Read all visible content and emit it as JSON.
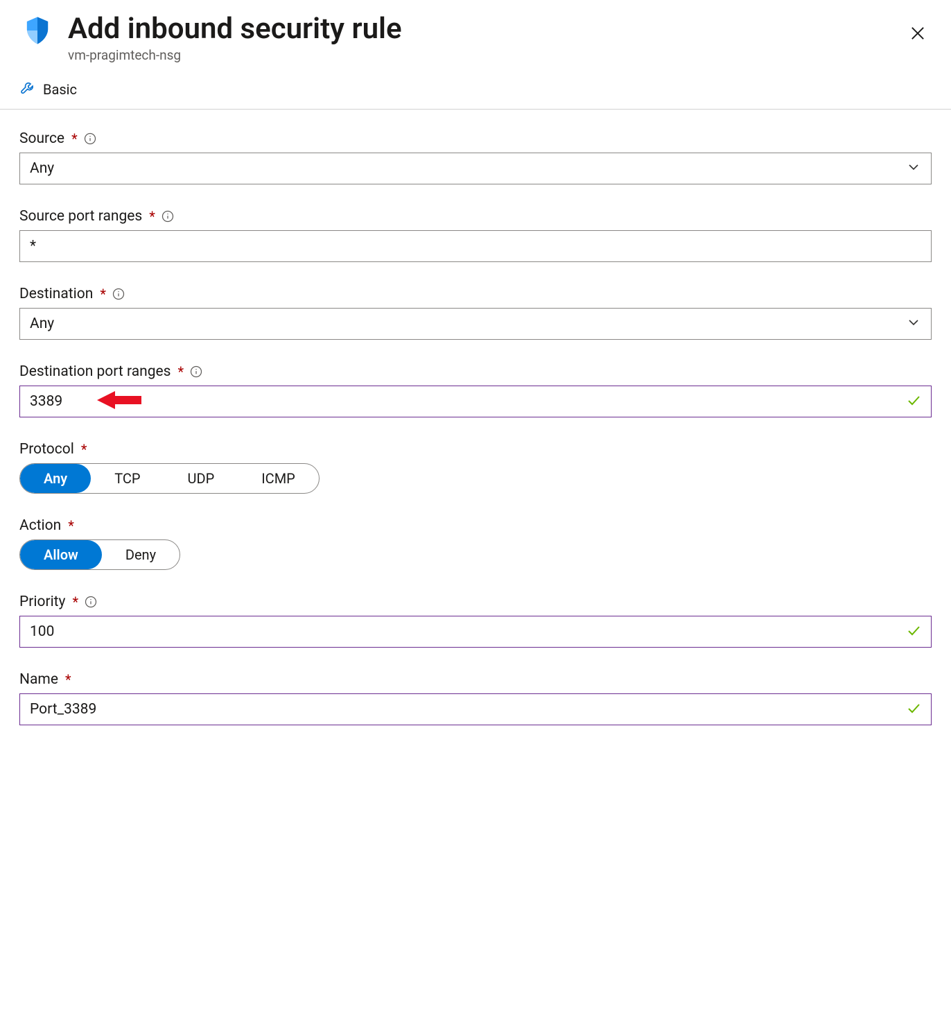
{
  "header": {
    "title": "Add inbound security rule",
    "subtitle": "vm-pragimtech-nsg"
  },
  "toolbar": {
    "basic_label": "Basic"
  },
  "fields": {
    "source": {
      "label": "Source",
      "value": "Any"
    },
    "source_port_ranges": {
      "label": "Source port ranges",
      "value": "*"
    },
    "destination": {
      "label": "Destination",
      "value": "Any"
    },
    "destination_port_ranges": {
      "label": "Destination port ranges",
      "value": "3389"
    },
    "protocol": {
      "label": "Protocol",
      "options": [
        "Any",
        "TCP",
        "UDP",
        "ICMP"
      ],
      "selected": "Any"
    },
    "action": {
      "label": "Action",
      "options": [
        "Allow",
        "Deny"
      ],
      "selected": "Allow"
    },
    "priority": {
      "label": "Priority",
      "value": "100"
    },
    "name": {
      "label": "Name",
      "value": "Port_3389"
    }
  }
}
